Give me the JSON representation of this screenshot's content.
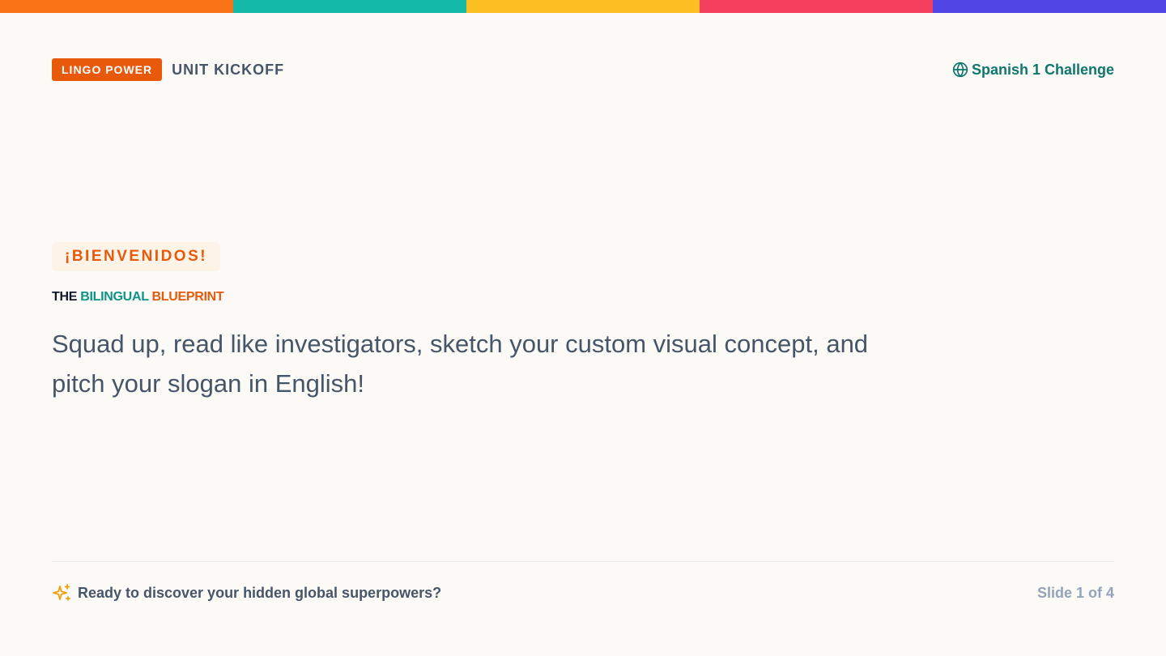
{
  "colors": {
    "stripe": [
      "#f97316",
      "#14b8a6",
      "#fbbf24",
      "#f43f5e",
      "#4f46e5"
    ],
    "accent_orange": "#e8590c",
    "accent_teal": "#0d9488",
    "background": "#fbfaf7"
  },
  "header": {
    "tag": "LINGO POWER",
    "kicker": "UNIT KICKOFF",
    "course_icon": "globe-icon",
    "course": "Spanish 1 Challenge"
  },
  "hero": {
    "welcome": "¡BIENVENIDOS!",
    "subtitle": {
      "word1": "THE",
      "word2": "BILINGUAL",
      "word3": "BLUEPRINT"
    },
    "body": "Squad up, read like investigators, sketch your custom visual concept, and pitch your slogan in English!"
  },
  "footer": {
    "icon": "sparkles-icon",
    "message": "Ready to discover your hidden global superpowers?",
    "slide_counter": "Slide 1 of 4"
  }
}
